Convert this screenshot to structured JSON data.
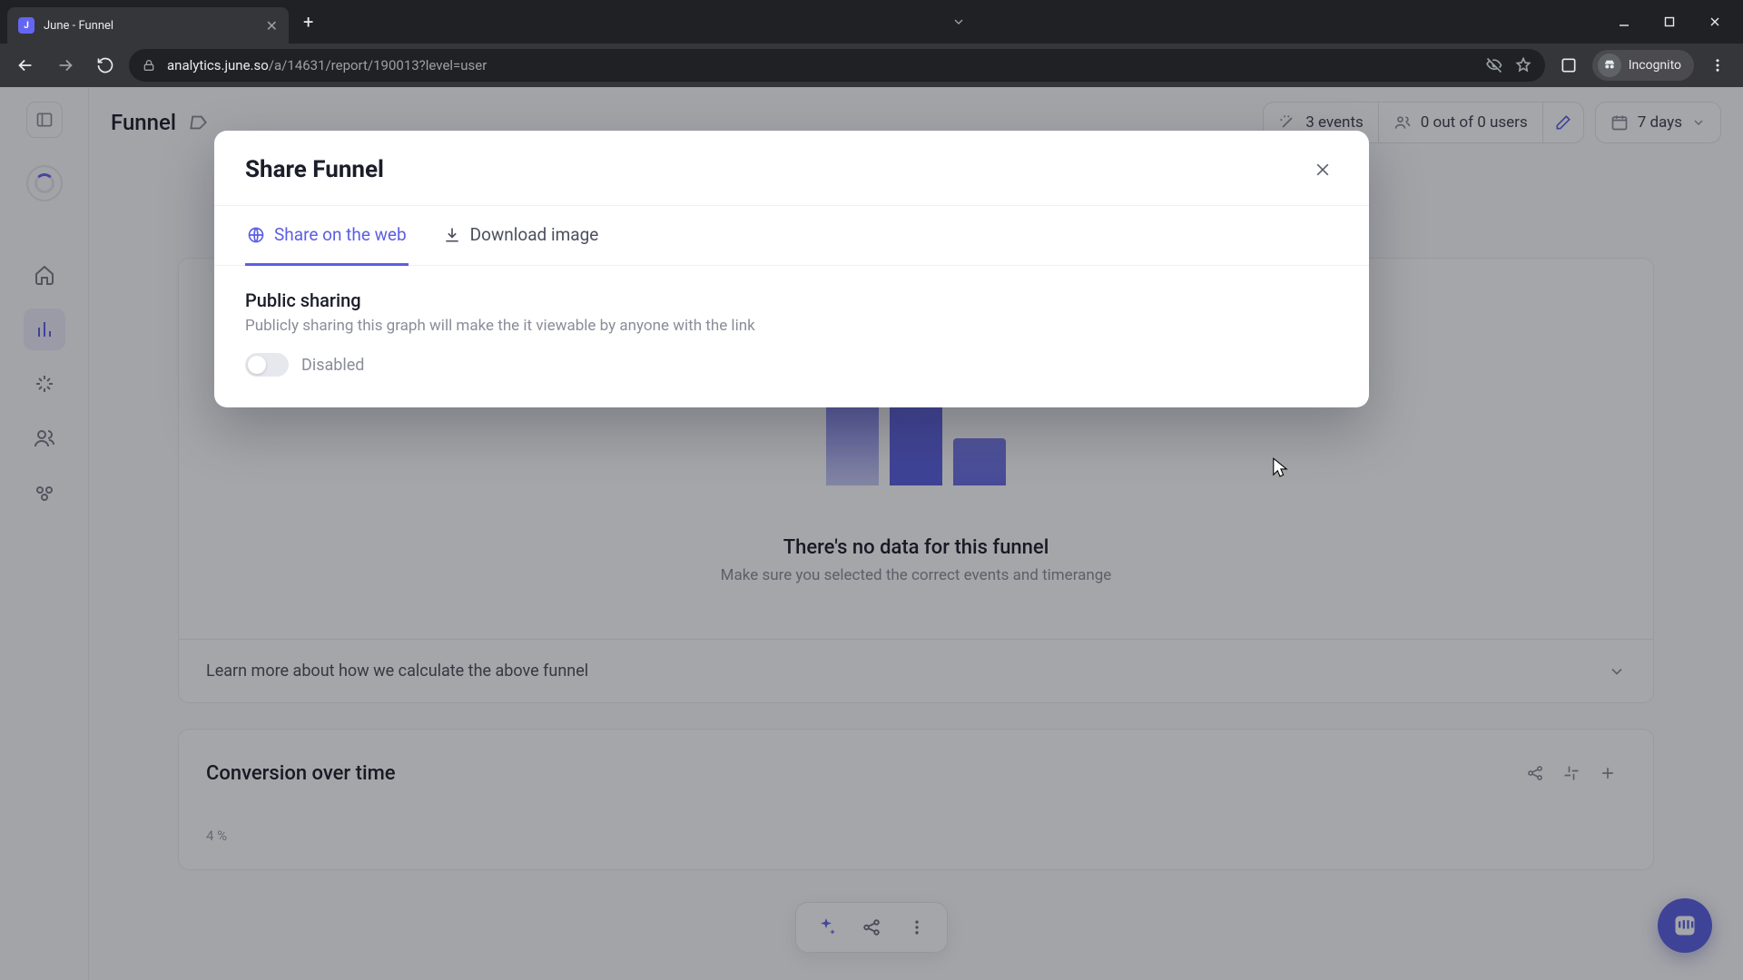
{
  "browser": {
    "tab_title": "June - Funnel",
    "url_host": "analytics.june.so",
    "url_path": "/a/14631/report/190013?level=user",
    "incognito_label": "Incognito"
  },
  "header": {
    "breadcrumb": "Funnel",
    "events_label": "3 events",
    "audience_label": "0 out of 0 users",
    "timerange_label": "7 days"
  },
  "empty_state": {
    "title": "There's no data for this funnel",
    "subtitle": "Make sure you selected the correct events and timerange",
    "learn_more": "Learn more about how we calculate the above funnel"
  },
  "conversion_card": {
    "title": "Conversion over time",
    "y_tick": "4 %"
  },
  "modal": {
    "title": "Share Funnel",
    "tabs": {
      "share_web": "Share on the web",
      "download_image": "Download image"
    },
    "public_sharing": {
      "heading": "Public sharing",
      "description": "Publicly sharing this graph will make the it viewable by anyone with the link",
      "toggle_state": "Disabled"
    }
  },
  "icons": {
    "rail": [
      "panel-toggle",
      "workspace-logo",
      "home",
      "reports",
      "insights",
      "users",
      "groups"
    ]
  }
}
